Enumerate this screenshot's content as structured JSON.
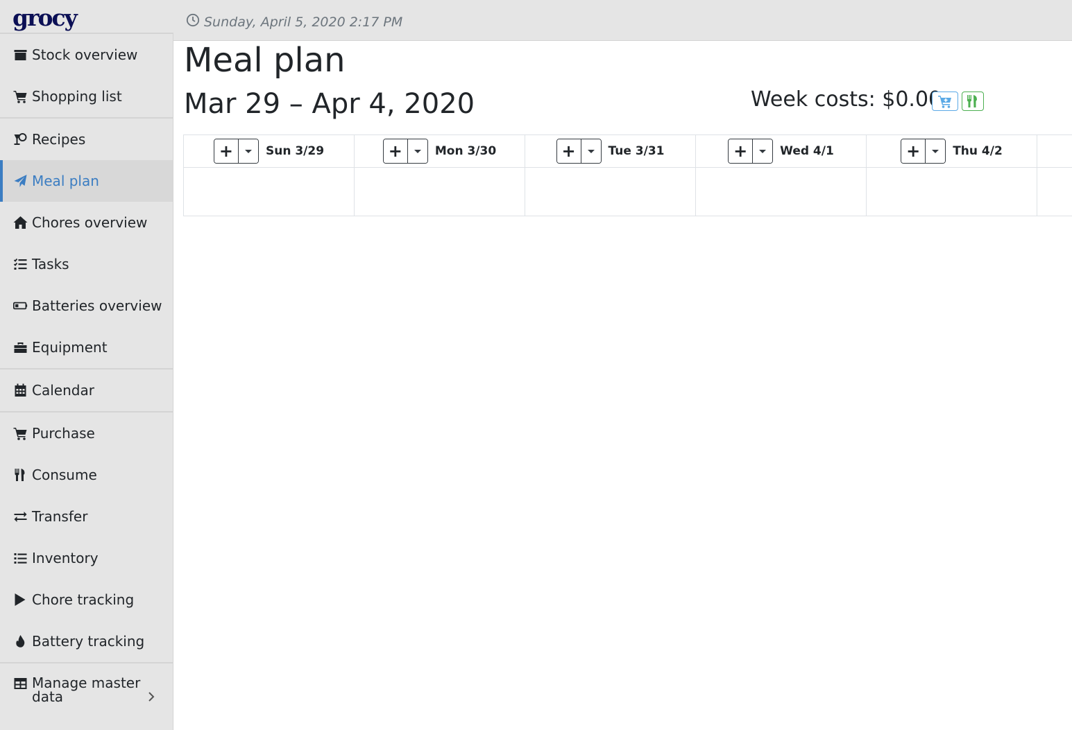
{
  "app": {
    "brand": "grocy"
  },
  "header": {
    "datetime": "Sunday, April 5, 2020 2:17 PM"
  },
  "sidebar": {
    "groups": [
      [
        {
          "label": "Stock overview",
          "icon": "box-icon"
        },
        {
          "label": "Shopping list",
          "icon": "cart-icon"
        }
      ],
      [
        {
          "label": "Recipes",
          "icon": "cocktail-icon"
        },
        {
          "label": "Meal plan",
          "icon": "paper-plane-icon",
          "active": true
        },
        {
          "label": "Chores overview",
          "icon": "home-icon"
        },
        {
          "label": "Tasks",
          "icon": "tasks-icon"
        },
        {
          "label": "Batteries overview",
          "icon": "battery-icon"
        },
        {
          "label": "Equipment",
          "icon": "toolbox-icon"
        }
      ],
      [
        {
          "label": "Calendar",
          "icon": "calendar-icon"
        }
      ],
      [
        {
          "label": "Purchase",
          "icon": "cart-icon"
        },
        {
          "label": "Consume",
          "icon": "utensils-icon"
        },
        {
          "label": "Transfer",
          "icon": "exchange-icon"
        },
        {
          "label": "Inventory",
          "icon": "list-icon"
        },
        {
          "label": "Chore tracking",
          "icon": "play-icon"
        },
        {
          "label": "Battery tracking",
          "icon": "fire-icon"
        }
      ],
      [
        {
          "label": "Manage master data",
          "icon": "table-icon"
        }
      ]
    ]
  },
  "main": {
    "title": "Meal plan",
    "week_range": "Mar 29 – Apr 4, 2020",
    "week_costs": "Week costs: $0.00",
    "days": [
      "Sun 3/29",
      "Mon 3/30",
      "Tue 3/31",
      "Wed 4/1",
      "Thu 4/2"
    ],
    "add_label": "+"
  },
  "colors": {
    "accent": "#3b7dc2",
    "cart_button": "#5aa9e6",
    "consume_button": "#4caf50",
    "brand": "#0b0f55"
  }
}
